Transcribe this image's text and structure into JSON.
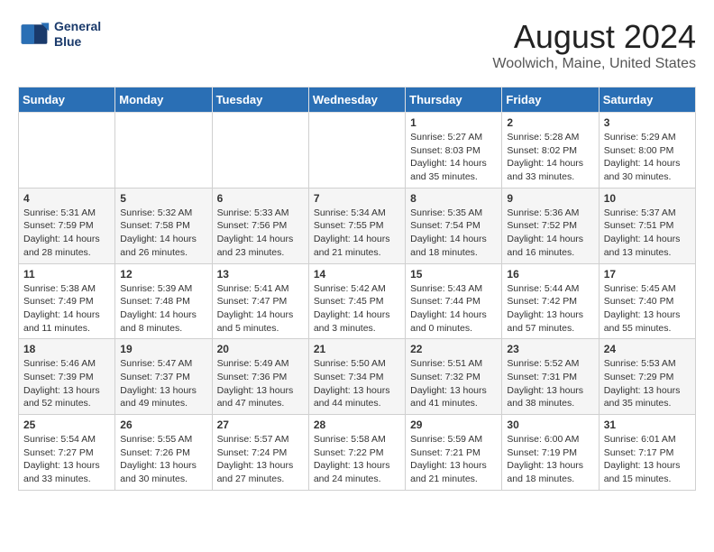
{
  "logo": {
    "line1": "General",
    "line2": "Blue"
  },
  "title": "August 2024",
  "subtitle": "Woolwich, Maine, United States",
  "days_of_week": [
    "Sunday",
    "Monday",
    "Tuesday",
    "Wednesday",
    "Thursday",
    "Friday",
    "Saturday"
  ],
  "weeks": [
    [
      {
        "day": "",
        "info": ""
      },
      {
        "day": "",
        "info": ""
      },
      {
        "day": "",
        "info": ""
      },
      {
        "day": "",
        "info": ""
      },
      {
        "day": "1",
        "info": "Sunrise: 5:27 AM\nSunset: 8:03 PM\nDaylight: 14 hours\nand 35 minutes."
      },
      {
        "day": "2",
        "info": "Sunrise: 5:28 AM\nSunset: 8:02 PM\nDaylight: 14 hours\nand 33 minutes."
      },
      {
        "day": "3",
        "info": "Sunrise: 5:29 AM\nSunset: 8:00 PM\nDaylight: 14 hours\nand 30 minutes."
      }
    ],
    [
      {
        "day": "4",
        "info": "Sunrise: 5:31 AM\nSunset: 7:59 PM\nDaylight: 14 hours\nand 28 minutes."
      },
      {
        "day": "5",
        "info": "Sunrise: 5:32 AM\nSunset: 7:58 PM\nDaylight: 14 hours\nand 26 minutes."
      },
      {
        "day": "6",
        "info": "Sunrise: 5:33 AM\nSunset: 7:56 PM\nDaylight: 14 hours\nand 23 minutes."
      },
      {
        "day": "7",
        "info": "Sunrise: 5:34 AM\nSunset: 7:55 PM\nDaylight: 14 hours\nand 21 minutes."
      },
      {
        "day": "8",
        "info": "Sunrise: 5:35 AM\nSunset: 7:54 PM\nDaylight: 14 hours\nand 18 minutes."
      },
      {
        "day": "9",
        "info": "Sunrise: 5:36 AM\nSunset: 7:52 PM\nDaylight: 14 hours\nand 16 minutes."
      },
      {
        "day": "10",
        "info": "Sunrise: 5:37 AM\nSunset: 7:51 PM\nDaylight: 14 hours\nand 13 minutes."
      }
    ],
    [
      {
        "day": "11",
        "info": "Sunrise: 5:38 AM\nSunset: 7:49 PM\nDaylight: 14 hours\nand 11 minutes."
      },
      {
        "day": "12",
        "info": "Sunrise: 5:39 AM\nSunset: 7:48 PM\nDaylight: 14 hours\nand 8 minutes."
      },
      {
        "day": "13",
        "info": "Sunrise: 5:41 AM\nSunset: 7:47 PM\nDaylight: 14 hours\nand 5 minutes."
      },
      {
        "day": "14",
        "info": "Sunrise: 5:42 AM\nSunset: 7:45 PM\nDaylight: 14 hours\nand 3 minutes."
      },
      {
        "day": "15",
        "info": "Sunrise: 5:43 AM\nSunset: 7:44 PM\nDaylight: 14 hours\nand 0 minutes."
      },
      {
        "day": "16",
        "info": "Sunrise: 5:44 AM\nSunset: 7:42 PM\nDaylight: 13 hours\nand 57 minutes."
      },
      {
        "day": "17",
        "info": "Sunrise: 5:45 AM\nSunset: 7:40 PM\nDaylight: 13 hours\nand 55 minutes."
      }
    ],
    [
      {
        "day": "18",
        "info": "Sunrise: 5:46 AM\nSunset: 7:39 PM\nDaylight: 13 hours\nand 52 minutes."
      },
      {
        "day": "19",
        "info": "Sunrise: 5:47 AM\nSunset: 7:37 PM\nDaylight: 13 hours\nand 49 minutes."
      },
      {
        "day": "20",
        "info": "Sunrise: 5:49 AM\nSunset: 7:36 PM\nDaylight: 13 hours\nand 47 minutes."
      },
      {
        "day": "21",
        "info": "Sunrise: 5:50 AM\nSunset: 7:34 PM\nDaylight: 13 hours\nand 44 minutes."
      },
      {
        "day": "22",
        "info": "Sunrise: 5:51 AM\nSunset: 7:32 PM\nDaylight: 13 hours\nand 41 minutes."
      },
      {
        "day": "23",
        "info": "Sunrise: 5:52 AM\nSunset: 7:31 PM\nDaylight: 13 hours\nand 38 minutes."
      },
      {
        "day": "24",
        "info": "Sunrise: 5:53 AM\nSunset: 7:29 PM\nDaylight: 13 hours\nand 35 minutes."
      }
    ],
    [
      {
        "day": "25",
        "info": "Sunrise: 5:54 AM\nSunset: 7:27 PM\nDaylight: 13 hours\nand 33 minutes."
      },
      {
        "day": "26",
        "info": "Sunrise: 5:55 AM\nSunset: 7:26 PM\nDaylight: 13 hours\nand 30 minutes."
      },
      {
        "day": "27",
        "info": "Sunrise: 5:57 AM\nSunset: 7:24 PM\nDaylight: 13 hours\nand 27 minutes."
      },
      {
        "day": "28",
        "info": "Sunrise: 5:58 AM\nSunset: 7:22 PM\nDaylight: 13 hours\nand 24 minutes."
      },
      {
        "day": "29",
        "info": "Sunrise: 5:59 AM\nSunset: 7:21 PM\nDaylight: 13 hours\nand 21 minutes."
      },
      {
        "day": "30",
        "info": "Sunrise: 6:00 AM\nSunset: 7:19 PM\nDaylight: 13 hours\nand 18 minutes."
      },
      {
        "day": "31",
        "info": "Sunrise: 6:01 AM\nSunset: 7:17 PM\nDaylight: 13 hours\nand 15 minutes."
      }
    ]
  ]
}
